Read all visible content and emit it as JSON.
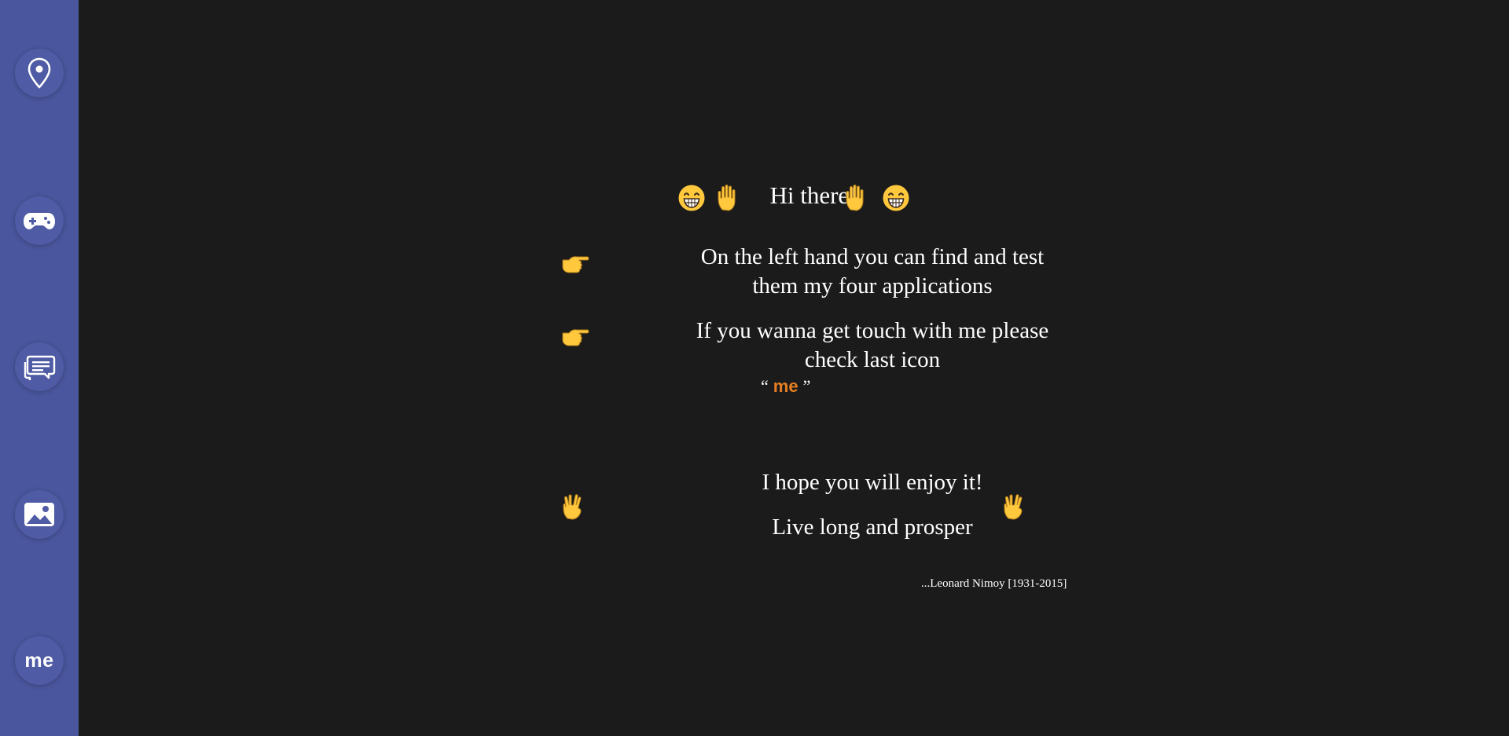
{
  "sidebar": {
    "items": [
      {
        "name": "location",
        "icon": "map-pin-icon"
      },
      {
        "name": "games",
        "icon": "gamepad-icon"
      },
      {
        "name": "chat",
        "icon": "chat-bubbles-icon"
      },
      {
        "name": "gallery",
        "icon": "image-icon"
      },
      {
        "name": "me",
        "icon": "me-text-icon",
        "label": "me"
      }
    ],
    "background": "#4a569d"
  },
  "main": {
    "greeting": "Hi there!",
    "greeting_icons": [
      "grinning-face-icon",
      "raised-hand-icon"
    ],
    "info_line_1a": "On the left hand you can find and test",
    "info_line_1b": "them my four applications",
    "info_line_2a": "If you wanna get touch with me please",
    "info_line_2b": "check last icon",
    "quote_open": "“",
    "quote_word": "me",
    "quote_close": "”",
    "pointer_icon": "pointing-right-hand-icon",
    "enjoy": "I hope you will enjoy it!",
    "prosper": "Live long and prosper",
    "vulcan_icon": "vulcan-salute-icon",
    "signature": "...Leonard Nimoy [1931-2015]"
  },
  "colors": {
    "background": "#1b1b1b",
    "accent": "#e67e22",
    "text": "#ffffff",
    "emoji": "#ffc83d"
  }
}
